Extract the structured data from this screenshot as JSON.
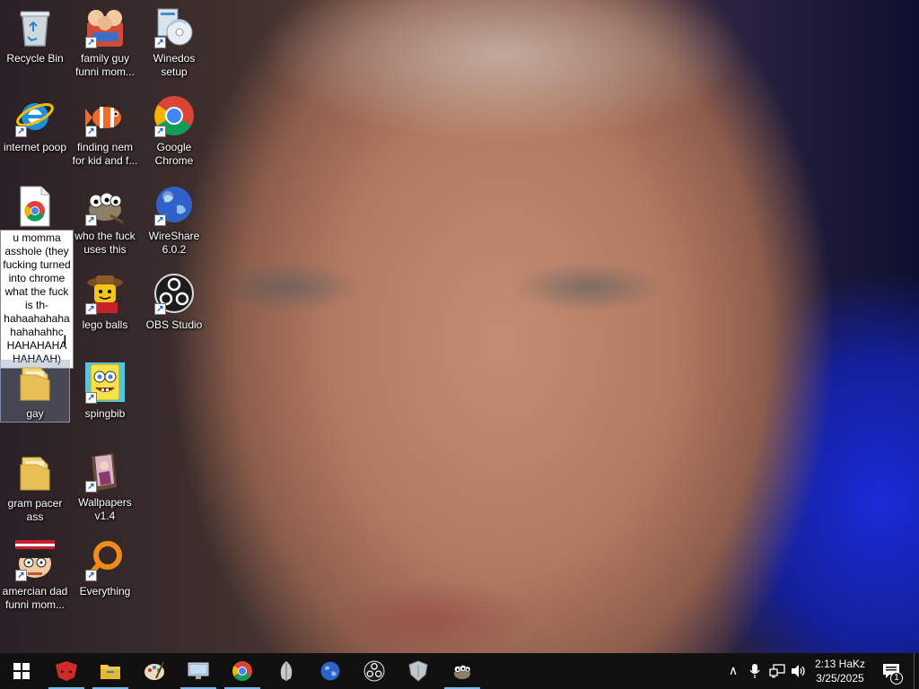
{
  "desktop_icons": [
    {
      "id": "recycle-bin",
      "label": "Recycle Bin",
      "icon": "recycle-bin-icon"
    },
    {
      "id": "internet-poop",
      "label": "internet poop",
      "icon": "internet-explorer-icon"
    },
    {
      "id": "chrome-file",
      "label": "u momma asshole (they fucking turned into chrome what the fuck is th-hahaahahaha hahahahhc HAHAHAHA HAHAAH)",
      "icon": "chrome-document-icon"
    },
    {
      "id": "gay-folder",
      "label": "gay",
      "icon": "folder-icon"
    },
    {
      "id": "gram-pacer-folder",
      "label": "gram pacer ass",
      "icon": "folder-icon"
    },
    {
      "id": "amercian-dad",
      "label": "amercian dad funni mom...",
      "icon": "american-dad-icon"
    },
    {
      "id": "family-guy",
      "label": "family guy funni mom...",
      "icon": "family-guy-icon"
    },
    {
      "id": "finding-nem",
      "label": "finding nem for kid and f...",
      "icon": "nemo-icon"
    },
    {
      "id": "who-uses-this",
      "label": "who the fuck uses this",
      "icon": "gimp-icon"
    },
    {
      "id": "lego-balls",
      "label": "lego balls",
      "icon": "lego-icon"
    },
    {
      "id": "spingbib",
      "label": "spingbib",
      "icon": "spongebob-icon"
    },
    {
      "id": "wallpapers",
      "label": "Wallpapers v1.4",
      "icon": "wallpapers-icon"
    },
    {
      "id": "winedos-setup",
      "label": "Winedos setup",
      "icon": "setup-disc-icon"
    },
    {
      "id": "google-chrome",
      "label": "Google Chrome",
      "icon": "chrome-icon"
    },
    {
      "id": "wireshare",
      "label": "WireShare 6.0.2",
      "icon": "globe-icon"
    },
    {
      "id": "obs-studio",
      "label": "OBS Studio",
      "icon": "obs-icon"
    },
    {
      "id": "everything",
      "label": "Everything",
      "icon": "everything-search-icon"
    }
  ],
  "taskbar": {
    "pinned": [
      {
        "name": "start-button",
        "icon": "windows-logo-icon"
      },
      {
        "name": "app-mask",
        "icon": "red-mask-icon"
      },
      {
        "name": "file-explorer",
        "icon": "folder-icon"
      },
      {
        "name": "paint",
        "icon": "paint-palette-icon"
      },
      {
        "name": "network-app",
        "icon": "monitor-icon"
      },
      {
        "name": "chrome",
        "icon": "chrome-icon"
      },
      {
        "name": "feather-app",
        "icon": "feather-icon"
      },
      {
        "name": "wireshare",
        "icon": "globe-icon"
      },
      {
        "name": "obs-studio",
        "icon": "obs-icon"
      },
      {
        "name": "shield-app",
        "icon": "shield-icon"
      },
      {
        "name": "gimp",
        "icon": "gimp-icon"
      }
    ],
    "tray": {
      "time": "2:13 HaKz",
      "date": "3/25/2025",
      "notification_count": "1"
    }
  },
  "colors": {
    "taskbar": "#101010",
    "accent": "#76b9ed",
    "selection": "#7890aa"
  }
}
